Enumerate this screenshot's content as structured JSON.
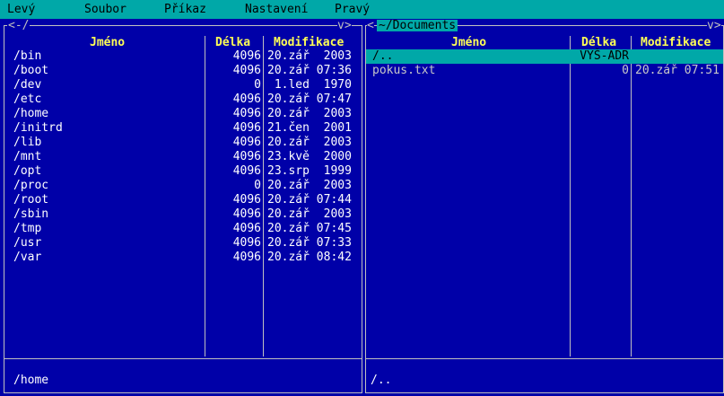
{
  "menu": [
    {
      "label": "Levý"
    },
    {
      "label": "Soubor"
    },
    {
      "label": "Příkaz"
    },
    {
      "label": "Nastavení"
    },
    {
      "label": "Pravý"
    }
  ],
  "left_panel": {
    "path_label": "<-/",
    "corner_right": "v>",
    "columns": {
      "name": "Jméno",
      "size": "Délka",
      "date": "Modifikace"
    },
    "rows": [
      {
        "name": "/bin",
        "size": "4096",
        "date": "20.zář  2003"
      },
      {
        "name": "/boot",
        "size": "4096",
        "date": "20.zář 07:36"
      },
      {
        "name": "/dev",
        "size": "0",
        "date": " 1.led  1970"
      },
      {
        "name": "/etc",
        "size": "4096",
        "date": "20.zář 07:47"
      },
      {
        "name": "/home",
        "size": "4096",
        "date": "20.zář  2003"
      },
      {
        "name": "/initrd",
        "size": "4096",
        "date": "21.čen  2001"
      },
      {
        "name": "/lib",
        "size": "4096",
        "date": "20.zář  2003"
      },
      {
        "name": "/mnt",
        "size": "4096",
        "date": "23.kvě  2000"
      },
      {
        "name": "/opt",
        "size": "4096",
        "date": "23.srp  1999"
      },
      {
        "name": "/proc",
        "size": "0",
        "date": "20.zář  2003"
      },
      {
        "name": "/root",
        "size": "4096",
        "date": "20.zář 07:44"
      },
      {
        "name": "/sbin",
        "size": "4096",
        "date": "20.zář  2003"
      },
      {
        "name": "/tmp",
        "size": "4096",
        "date": "20.zář 07:45"
      },
      {
        "name": "/usr",
        "size": "4096",
        "date": "20.zář 07:33"
      },
      {
        "name": "/var",
        "size": "4096",
        "date": "20.zář 08:42"
      }
    ],
    "status": "/home"
  },
  "right_panel": {
    "corner_left": "<",
    "path_label": "~/Documents",
    "corner_right": "v>",
    "columns": {
      "name": "Jméno",
      "size": "Délka",
      "date": "Modifikace"
    },
    "rows": [
      {
        "name": "/..",
        "size": "VYŠ-ADR",
        "date": ""
      },
      {
        "name": "pokus.txt",
        "size": "0",
        "date": "20.zář 07:51"
      }
    ],
    "status": "/.."
  },
  "colors": {
    "panel_bg": "#0000a8",
    "menu_bg": "#00a8a8",
    "header_text": "#ffff55",
    "selection_bg": "#00a8a8"
  }
}
